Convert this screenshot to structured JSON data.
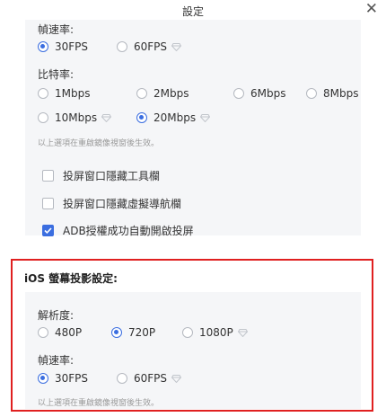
{
  "window": {
    "title": "設定",
    "close_icon": "close-icon"
  },
  "android": {
    "framerate": {
      "label": "幀速率:",
      "options": [
        {
          "label": "30FPS",
          "selected": true
        },
        {
          "label": "60FPS",
          "selected": false,
          "premium": true
        }
      ]
    },
    "bitrate": {
      "label": "比特率:",
      "options": [
        {
          "label": "1Mbps",
          "selected": false
        },
        {
          "label": "2Mbps",
          "selected": false
        },
        {
          "label": "6Mbps",
          "selected": false
        },
        {
          "label": "8Mbps",
          "selected": false
        },
        {
          "label": "10Mbps",
          "selected": false,
          "premium": true
        },
        {
          "label": "20Mbps",
          "selected": true,
          "premium": true
        }
      ]
    },
    "note": "以上選項在重啟鏡像視窗後生效。",
    "checkboxes": [
      {
        "label": "投屏窗口隱藏工具欄",
        "checked": false
      },
      {
        "label": "投屏窗口隱藏虛擬導航欄",
        "checked": false
      },
      {
        "label": "ADB授權成功自動開啟投屏",
        "checked": true
      }
    ]
  },
  "ios": {
    "title": "iOS 螢幕投影設定:",
    "resolution": {
      "label": "解析度:",
      "options": [
        {
          "label": "480P",
          "selected": false
        },
        {
          "label": "720P",
          "selected": true
        },
        {
          "label": "1080P",
          "selected": false,
          "premium": true
        }
      ]
    },
    "framerate": {
      "label": "幀速率:",
      "options": [
        {
          "label": "30FPS",
          "selected": true
        },
        {
          "label": "60FPS",
          "selected": false,
          "premium": true
        }
      ]
    },
    "note": "以上選項在重啟鏡像視窗後生效。"
  },
  "colors": {
    "accent": "#3b6ee0",
    "highlight_frame": "#e02020",
    "panel_bg": "#f5f6f8"
  }
}
